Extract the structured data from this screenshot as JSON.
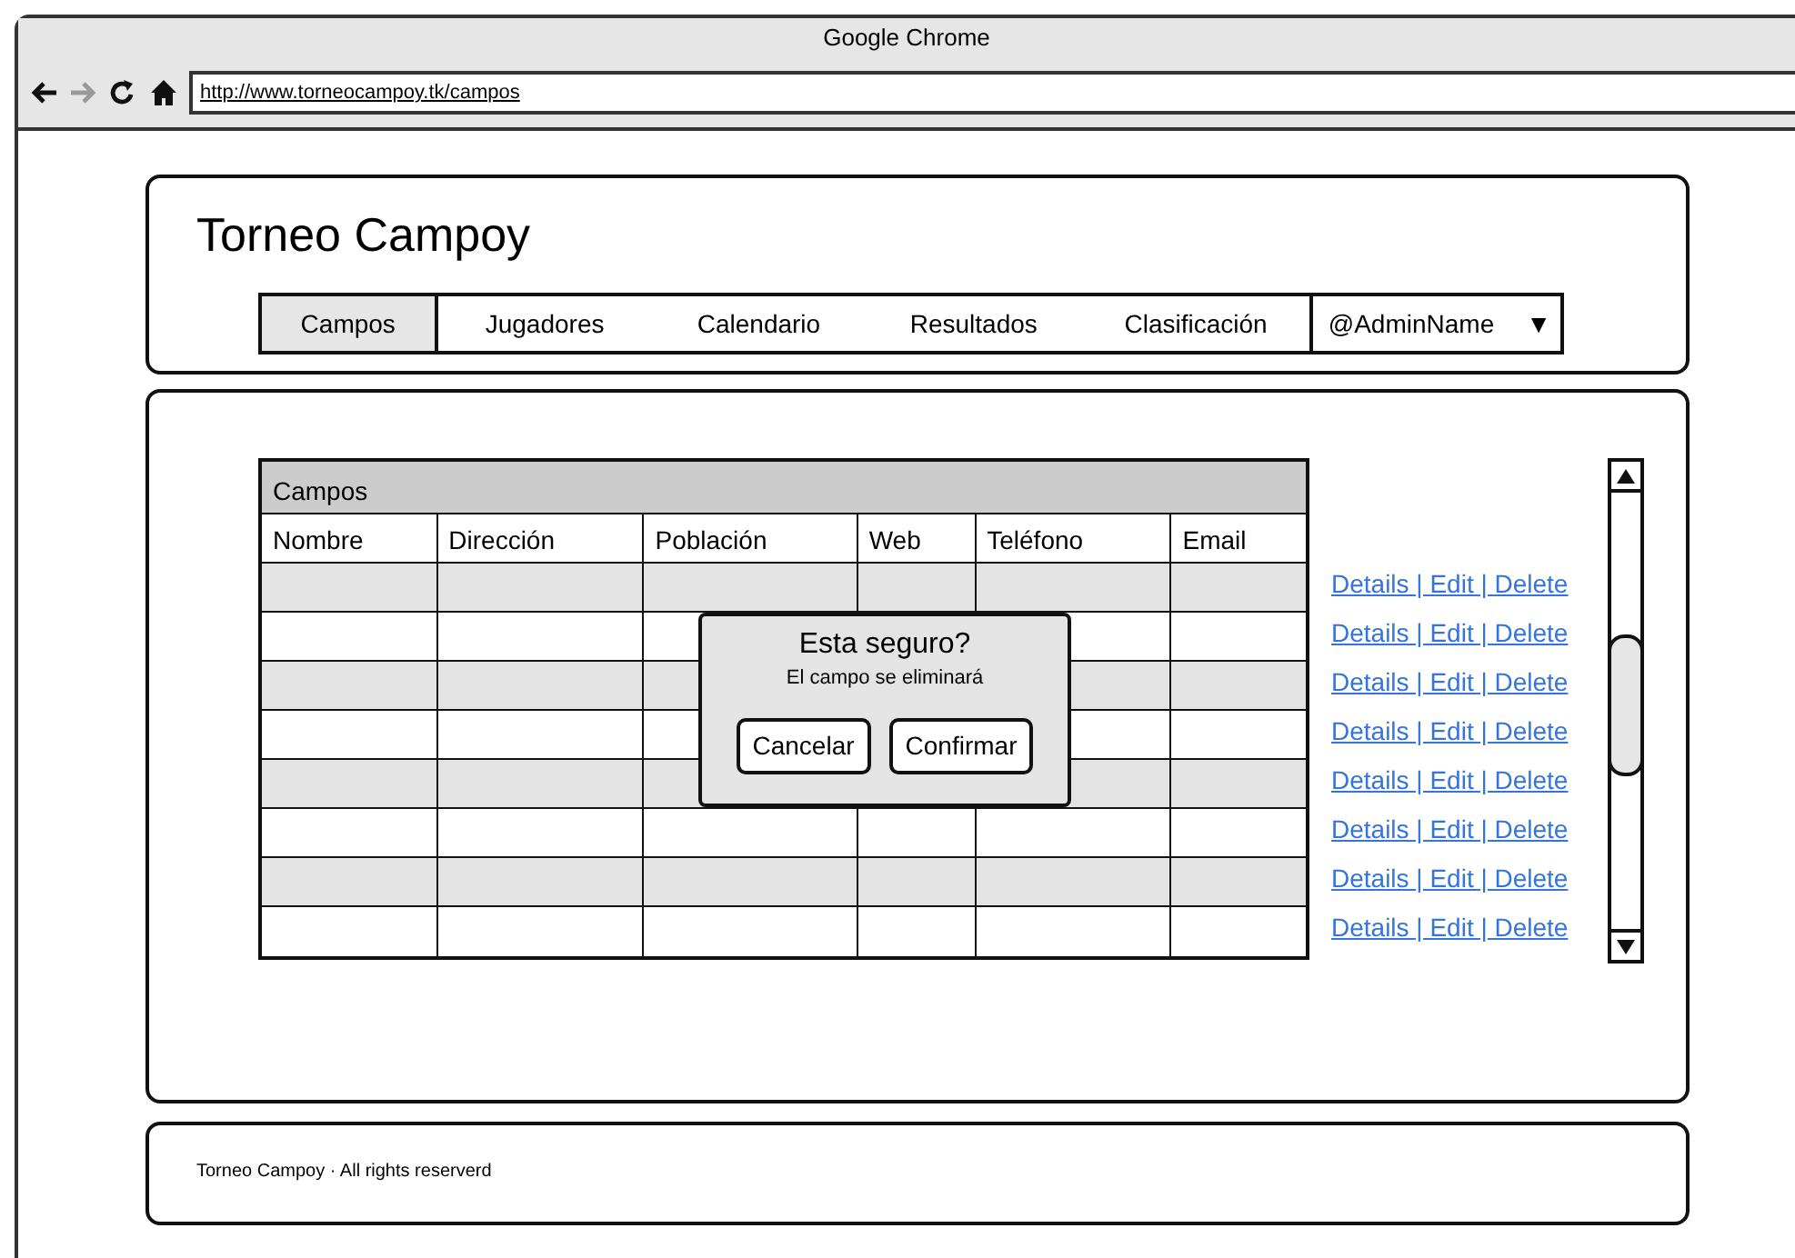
{
  "window": {
    "title": "Google Chrome"
  },
  "toolbar": {
    "nav_buttons": [
      {
        "kind": "back",
        "disabled": false
      },
      {
        "kind": "forward",
        "disabled": true
      },
      {
        "kind": "reload",
        "disabled": false
      },
      {
        "kind": "home",
        "disabled": false
      }
    ],
    "url": "http://www.torneocampoy.tk/campos"
  },
  "header": {
    "site_title": "Torneo Campoy",
    "tabs": [
      {
        "label": "Campos",
        "selected": true
      },
      {
        "label": "Jugadores",
        "selected": false
      },
      {
        "label": "Calendario",
        "selected": false
      },
      {
        "label": "Resultados",
        "selected": false
      },
      {
        "label": "Clasificación",
        "selected": false
      }
    ],
    "user_menu": {
      "label": "@AdminName",
      "caret": "▼"
    }
  },
  "table": {
    "title": "Campos",
    "columns": [
      "Nombre",
      "Dirección",
      "Población",
      "Web",
      "Teléfono",
      "Email"
    ],
    "rows": [
      {
        "shaded": true,
        "action_link": "Details | Edit | Delete"
      },
      {
        "shaded": false,
        "action_link": "Details | Edit | Delete"
      },
      {
        "shaded": true,
        "action_link": "Details | Edit | Delete"
      },
      {
        "shaded": false,
        "action_link": "Details | Edit | Delete"
      },
      {
        "shaded": true,
        "action_link": "Details | Edit | Delete"
      },
      {
        "shaded": false,
        "action_link": "Details | Edit | Delete"
      },
      {
        "shaded": true,
        "action_link": "Details | Edit | Delete"
      },
      {
        "shaded": false,
        "action_link": "Details | Edit | Delete"
      }
    ]
  },
  "dialog": {
    "title": "Esta seguro?",
    "message": "El campo se eliminará",
    "buttons": [
      "Cancelar",
      "Confirmar"
    ]
  },
  "footer": {
    "text": "Torneo Campoy · All rights reserverd"
  }
}
